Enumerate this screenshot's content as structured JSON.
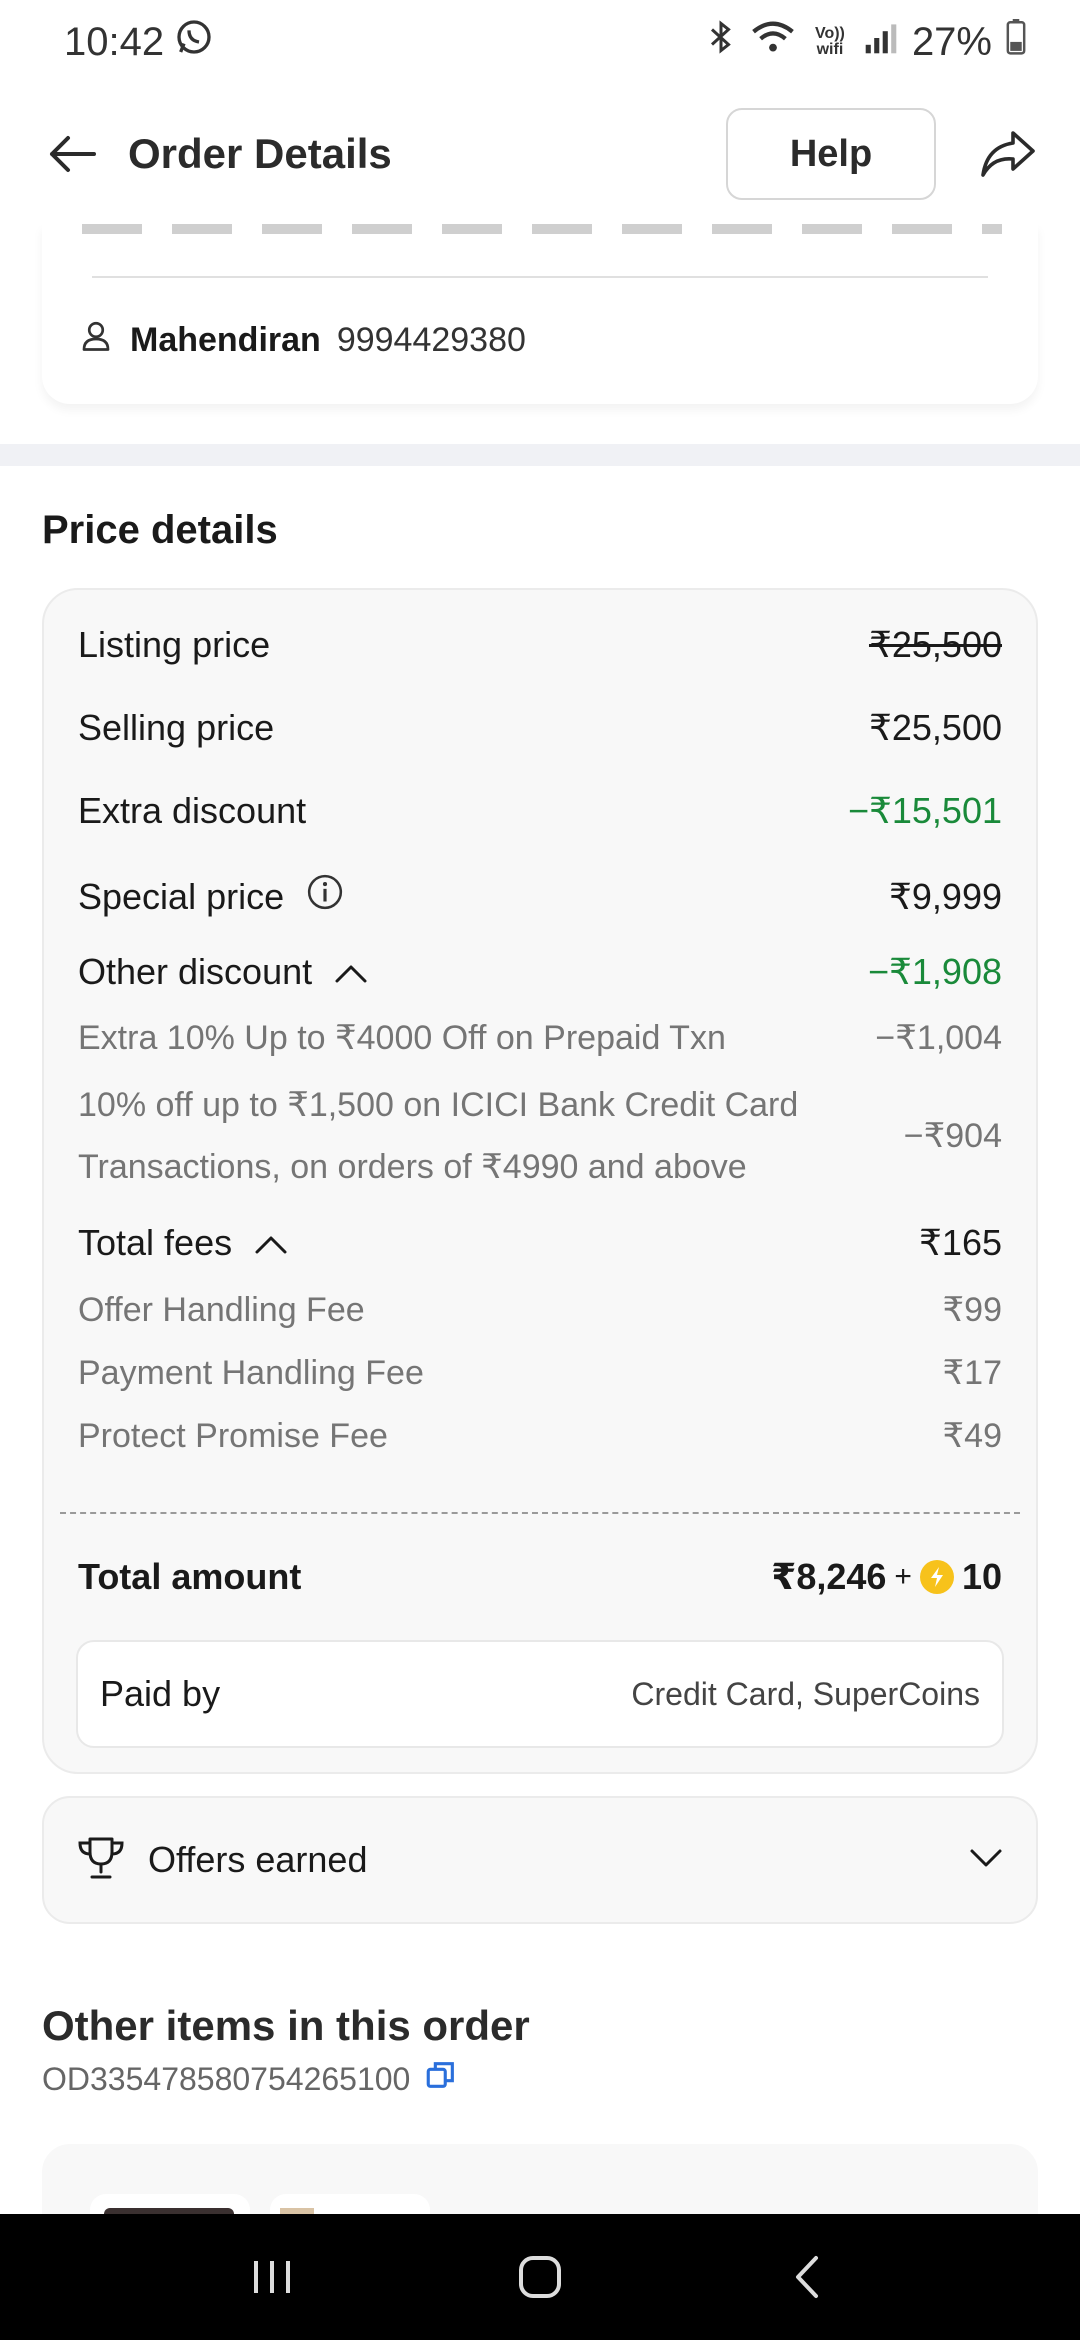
{
  "status_bar": {
    "time": "10:42",
    "battery": "27%",
    "wifi_label": "Vo)) wifi",
    "icons": [
      "whatsapp-icon",
      "bluetooth-icon",
      "wifi-icon",
      "signal-icon",
      "battery-icon"
    ]
  },
  "app_bar": {
    "title": "Order Details",
    "help_label": "Help"
  },
  "address": {
    "name": "Mahendiran",
    "phone": "9994429380"
  },
  "price_details": {
    "title": "Price details",
    "listing_label": "Listing price",
    "listing_value": "₹25,500",
    "selling_label": "Selling price",
    "selling_value": "₹25,500",
    "extra_discount_label": "Extra discount",
    "extra_discount_value": "−₹15,501",
    "special_label": "Special price",
    "special_value": "₹9,999",
    "other_discount_label": "Other discount",
    "other_discount_value": "−₹1,908",
    "other_discount_items": [
      {
        "label": "Extra 10% Up to ₹4000 Off on Prepaid Txn",
        "value": "−₹1,004"
      },
      {
        "label_line1": "10% off up to ₹1,500 on ICICI Bank Credit Card",
        "label_line2": "Transactions, on orders of ₹4990 and above",
        "value": "−₹904"
      }
    ],
    "total_fees_label": "Total fees",
    "total_fees_value": "₹165",
    "fee_items": [
      {
        "label": "Offer Handling Fee",
        "value": "₹99"
      },
      {
        "label": "Payment Handling Fee",
        "value": "₹17"
      },
      {
        "label": "Protect Promise Fee",
        "value": "₹49"
      }
    ],
    "total_label": "Total amount",
    "total_value": "₹8,246",
    "plus": "+",
    "supercoins": "10",
    "paid_by_label": "Paid by",
    "paid_by_value": "Credit Card, SuperCoins"
  },
  "offers": {
    "label": "Offers earned"
  },
  "other_items": {
    "title": "Other items in this order",
    "order_id": "OD335478580754265100"
  },
  "colors": {
    "discount_green": "#1a8a3a",
    "copy_blue": "#2a6fdb",
    "supercoin_yellow": "#f7c21b"
  }
}
